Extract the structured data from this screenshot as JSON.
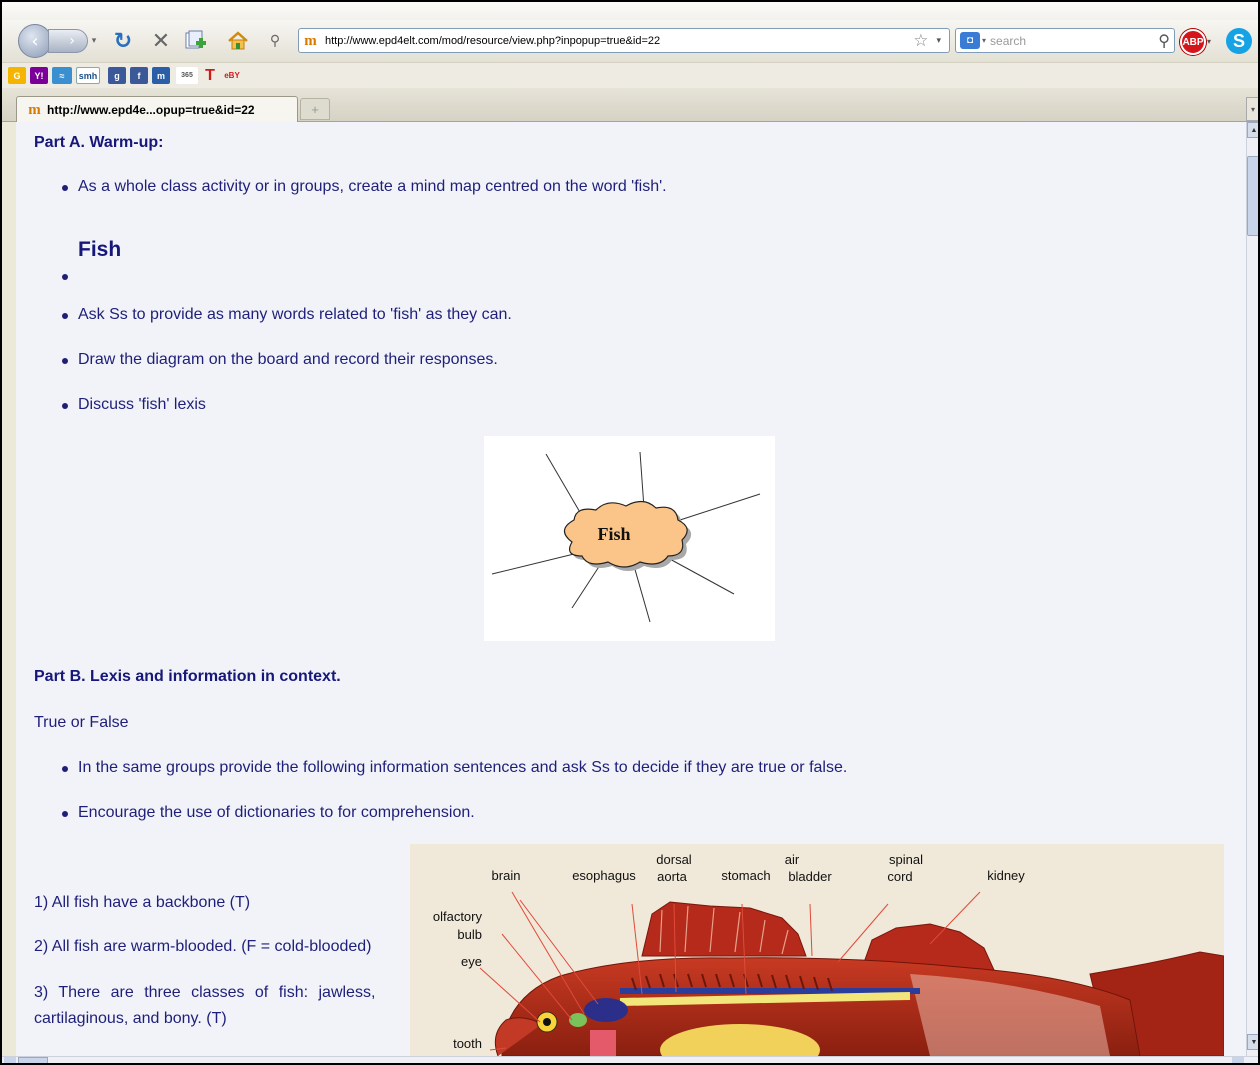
{
  "browser": {
    "url": "http://www.epd4elt.com/mod/resource/view.php?inpopup=true&id=22",
    "search_placeholder": "search",
    "tab_title": "http://www.epd4e...opup=true&id=22",
    "new_tab_glyph": "+",
    "favicon_glyph": "m",
    "abp_label": "ABP",
    "accent_color": "#2a6fbe"
  },
  "bookmarks": [
    {
      "name": "google-bookmark",
      "label": "G",
      "color": "#2a7ae2"
    },
    {
      "name": "yahoo-bookmark",
      "label": "Y!",
      "color": "#7b0099"
    },
    {
      "name": "bookmark-3",
      "label": "≈",
      "color": "#3a8fd0"
    },
    {
      "name": "smh-bookmark",
      "label": "smh",
      "color": "#1a4f8a"
    },
    {
      "name": "bookmark-5",
      "label": "g",
      "color": "#3b5998"
    },
    {
      "name": "facebook-bookmark",
      "label": "f",
      "color": "#3b5998"
    },
    {
      "name": "bookmark-7",
      "label": "m",
      "color": "#2a5fa8"
    },
    {
      "name": "bookmark-365",
      "label": "365",
      "color": "#555555"
    },
    {
      "name": "bookmark-t",
      "label": "T",
      "color": "#d01b1b"
    },
    {
      "name": "ebay-bookmark",
      "label": "eBY",
      "color": "#d01b1b"
    }
  ],
  "content": {
    "partA_heading": "Part A. Warm-up:",
    "partA_bullet1": "As a whole class activity or in groups, create a mind map centred on the word 'fish'.",
    "fish_heading": "Fish",
    "partA_bullet2": "Ask Ss to provide as many words related to 'fish' as they can.",
    "partA_bullet3": "Draw the diagram on the board and record their responses.",
    "partA_bullet4": "Discuss 'fish' lexis",
    "mindmap_center": "Fish",
    "partB_heading": "Part B. Lexis and information in context.",
    "true_false": "True or False",
    "partB_bullet1": "In the same groups provide the following information sentences and ask Ss to decide if they are true or false.",
    "partB_bullet2": "Encourage the use of dictionaries to for comprehension.",
    "statement1": "1) All fish have a backbone (T)",
    "statement2": "2) All fish are warm-blooded. (F = cold-blooded)",
    "statement3a": "3) There are three classes of fish: jawless,",
    "statement3b": "cartilaginous, and bony. (T)"
  },
  "fish_diagram": {
    "labels": {
      "brain": "brain",
      "esophagus": "esophagus",
      "dorsal_aorta_1": "dorsal",
      "dorsal_aorta_2": "aorta",
      "stomach": "stomach",
      "air_bladder_1": "air",
      "air_bladder_2": "bladder",
      "spinal_cord_1": "spinal",
      "spinal_cord_2": "cord",
      "kidney": "kidney",
      "olfactory_1": "olfactory",
      "olfactory_2": "bulb",
      "eye": "eye",
      "tooth": "tooth"
    }
  }
}
